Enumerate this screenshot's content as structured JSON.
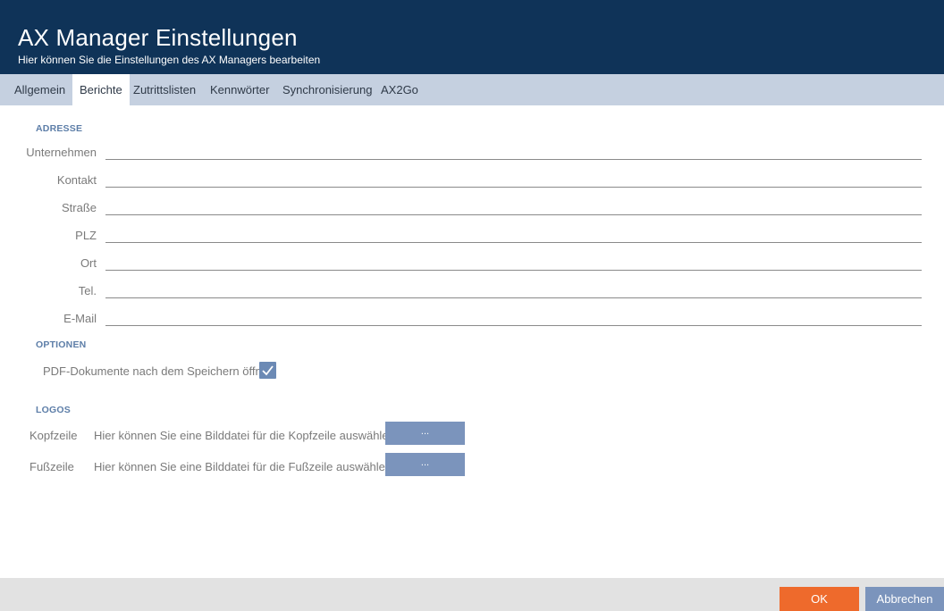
{
  "header": {
    "title": "AX Manager Einstellungen",
    "subtitle": "Hier können Sie die Einstellungen des AX Managers bearbeiten"
  },
  "tabs": [
    {
      "label": "Allgemein",
      "active": false
    },
    {
      "label": "Berichte",
      "active": true
    },
    {
      "label": "Zutrittslisten",
      "active": false
    },
    {
      "label": "Kennwörter",
      "active": false
    },
    {
      "label": "Synchronisierung",
      "active": false
    },
    {
      "label": "AX2Go",
      "active": false
    }
  ],
  "address": {
    "section_title": "ADRESSE",
    "fields": [
      {
        "label": "Unternehmen",
        "value": ""
      },
      {
        "label": "Kontakt",
        "value": ""
      },
      {
        "label": "Straße",
        "value": ""
      },
      {
        "label": "PLZ",
        "value": ""
      },
      {
        "label": "Ort",
        "value": ""
      },
      {
        "label": "Tel.",
        "value": ""
      },
      {
        "label": "E-Mail",
        "value": ""
      }
    ]
  },
  "options": {
    "section_title": "OPTIONEN",
    "open_pdf_label": "PDF-Dokumente nach dem Speichern öffnen",
    "open_pdf_checked": true
  },
  "logos": {
    "section_title": "LOGOS",
    "items": [
      {
        "name": "Kopfzeile",
        "description": "Hier können Sie eine Bilddatei für die Kopfzeile auswählen",
        "button_label": "..."
      },
      {
        "name": "Fußzeile",
        "description": "Hier können Sie eine Bilddatei für die Fußzeile auswählen",
        "button_label": "..."
      }
    ]
  },
  "footer": {
    "ok_label": "OK",
    "cancel_label": "Abbrechen"
  },
  "colors": {
    "header_bg": "#0f3358",
    "tabbar_bg": "#c5d0e0",
    "section_title": "#5d7ea8",
    "accent_button": "#7b94bc",
    "ok_button": "#ee6a2c",
    "footer_bg": "#e2e2e2"
  }
}
